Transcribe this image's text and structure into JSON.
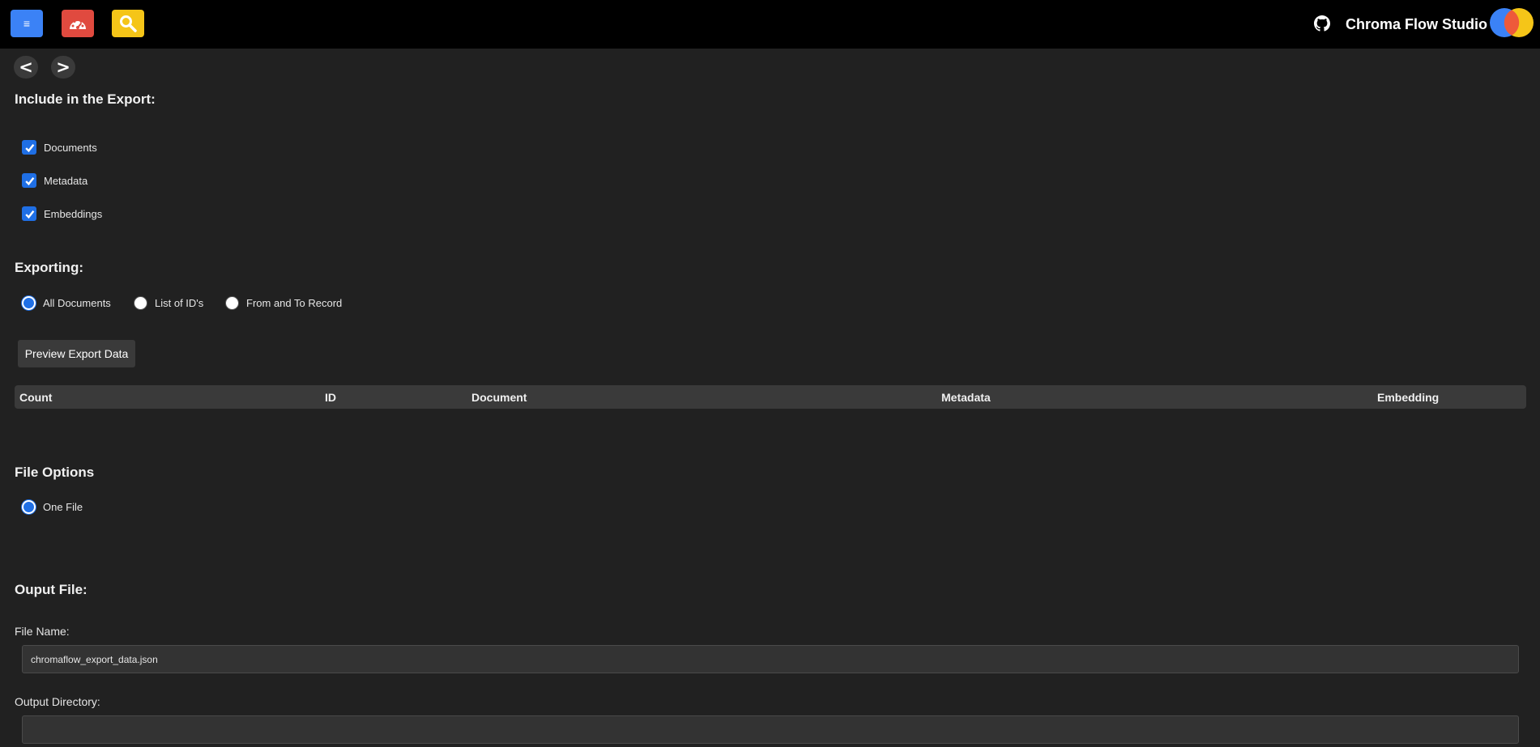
{
  "app": {
    "title": "Chroma Flow Studio"
  },
  "topbar": {
    "menu_icon": "≡",
    "icons": [
      "menu-icon",
      "dashboard-icon",
      "search-icon",
      "github-icon",
      "logo"
    ]
  },
  "nav": {
    "back": "<",
    "forward": ">"
  },
  "include": {
    "heading": "Include in the Export:",
    "options": [
      {
        "label": "Documents",
        "checked": true
      },
      {
        "label": "Metadata",
        "checked": true
      },
      {
        "label": "Embeddings",
        "checked": true
      }
    ]
  },
  "exporting": {
    "heading": "Exporting:",
    "options": [
      {
        "label": "All Documents",
        "selected": true
      },
      {
        "label": "List of ID's",
        "selected": false
      },
      {
        "label": "From and To Record",
        "selected": false
      }
    ]
  },
  "preview_button": "Preview Export Data",
  "table": {
    "columns": [
      "Count",
      "ID",
      "Document",
      "Metadata",
      "Embedding"
    ]
  },
  "file_options": {
    "heading": "File Options",
    "options": [
      {
        "label": "One File",
        "selected": true
      }
    ]
  },
  "output": {
    "heading": "Ouput File:",
    "file_name_label": "File Name:",
    "file_name_value": "chromaflow_export_data.json",
    "output_dir_label": "Output Directory:",
    "output_dir_value": ""
  },
  "colors": {
    "background": "#212121",
    "topbar": "#000000",
    "accent_blue": "#1f6fe5",
    "menu_button": "#3b82f6",
    "dashboard_button": "#e04a3f",
    "search_button": "#f5c518"
  }
}
